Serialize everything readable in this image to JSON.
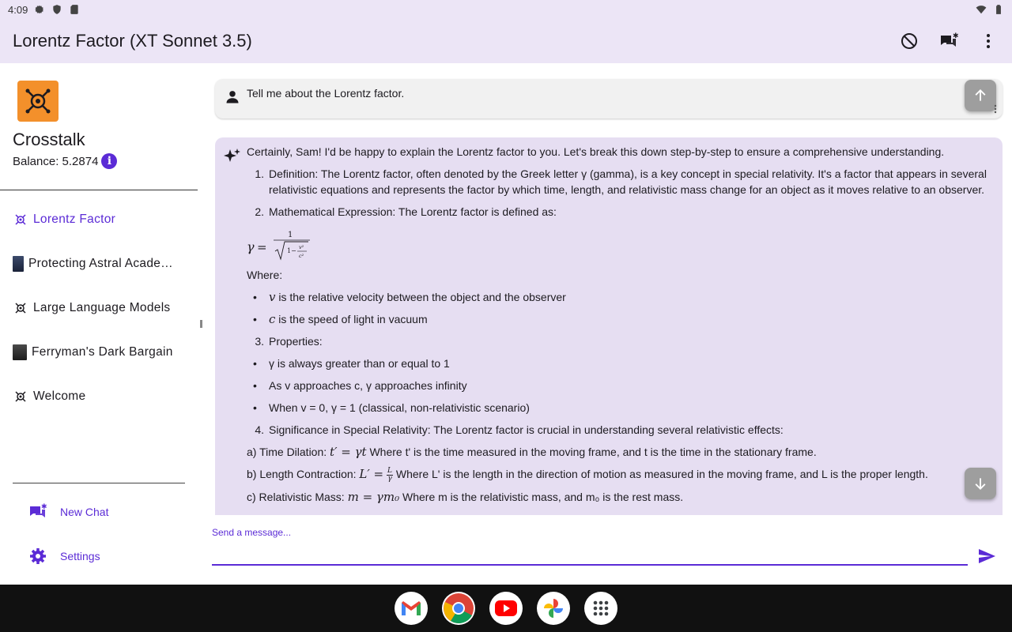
{
  "status": {
    "time": "4:09"
  },
  "appbar": {
    "title": "Lorentz Factor (XT Sonnet 3.5)"
  },
  "sidebar": {
    "app_name": "Crosstalk",
    "balance": "Balance: 5.2874",
    "chats": [
      {
        "label": "Lorentz Factor",
        "icon": "crosstalk-logo-icon"
      },
      {
        "label": "Protecting Astral Acade…",
        "icon": "avatar-thumbnail"
      },
      {
        "label": "Large Language Models",
        "icon": "crosstalk-logo-icon"
      },
      {
        "label": "Ferryman's Dark Bargain",
        "icon": "avatar-thumbnail"
      },
      {
        "label": "Welcome",
        "icon": "crosstalk-logo-icon"
      }
    ],
    "new_chat": "New Chat",
    "settings": "Settings"
  },
  "conversation": {
    "user_message": "Tell me about the Lorentz factor.",
    "ai": {
      "intro": "Certainly, Sam! I'd be happy to explain the Lorentz factor to you. Let's break this down step-by-step to ensure a comprehensive understanding.",
      "item1_num": "1.",
      "item1": "Definition: The Lorentz factor, often denoted by the Greek letter γ (gamma), is a key concept in special relativity. It's a factor that appears in several relativistic equations and represents the factor by which time, length, and relativistic mass change for an object as it moves relative to an observer.",
      "item2_num": "2.",
      "item2": "Mathematical Expression: The Lorentz factor is defined as:",
      "where": "Where:",
      "b1_var": "v",
      "b1": " is the relative velocity between the object and the observer",
      "b2_var": "c",
      "b2": " is the speed of light in vacuum",
      "item3_num": "3.",
      "item3": "Properties:",
      "p1": "γ is always greater than or equal to 1",
      "p2": "As v approaches c, γ approaches infinity",
      "p3": "When v = 0, γ = 1 (classical, non-relativistic scenario)",
      "item4_num": "4.",
      "item4": "Significance in Special Relativity: The Lorentz factor is crucial in understanding several relativistic effects:",
      "a_label": "a) Time Dilation: ",
      "a_math": "t′ = γt",
      "a_text": " Where t' is the time measured in the moving frame, and t is the time in the stationary frame.",
      "b_label": "b) Length Contraction: ",
      "b_math_lhs": "L′ =",
      "b_math_num": "L",
      "b_math_den": "γ",
      "b_text": " Where L' is the length in the direction of motion as measured in the moving frame, and L is the proper length.",
      "c_label": "c) Relativistic Mass: ",
      "c_math": "m = γm₀",
      "c_text": " Where m is the relativistic mass, and m₀ is the rest mass."
    }
  },
  "composer": {
    "placeholder": "Send a message..."
  },
  "colors": {
    "accent": "#5b2bd6",
    "appbar": "#ece5f6",
    "ai_bubble": "#e6def2",
    "logo": "#f3902b"
  }
}
